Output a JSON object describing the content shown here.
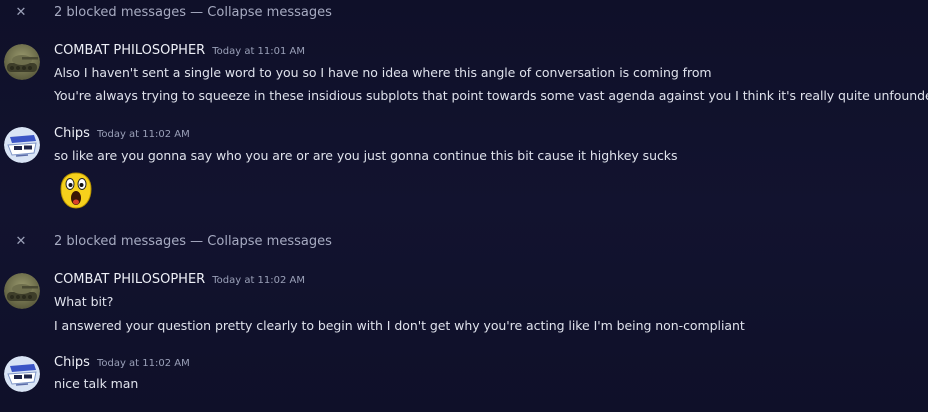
{
  "blocked_1": {
    "close_glyph": "✕",
    "count_text": "2 blocked messages",
    "separator": "—",
    "action": "Collapse messages"
  },
  "msg_1": {
    "username": "COMBAT PHILOSOPHER",
    "timestamp": "Today at 11:01 AM",
    "lines": [
      "Also I haven't sent a single word to you so I have no idea where this angle of conversation is coming from",
      "You're always trying to squeeze in these insidious subplots that point towards some vast agenda against you I think it's really quite unfounded"
    ]
  },
  "msg_2": {
    "username": "Chips",
    "timestamp": "Today at 11:02 AM",
    "lines": [
      "so like are you gonna say who you are or are you just gonna continue this bit cause it highkey sucks"
    ],
    "emoji": "screaming-yellow-face-icon"
  },
  "blocked_2": {
    "close_glyph": "✕",
    "count_text": "2 blocked messages",
    "separator": "—",
    "action": "Collapse messages"
  },
  "msg_3": {
    "username": "COMBAT PHILOSOPHER",
    "timestamp": "Today at 11:02 AM",
    "lines": [
      "What bit?",
      "I answered your question pretty clearly to begin with I don't get why you're acting like I'm being non-compliant"
    ]
  },
  "msg_4": {
    "username": "Chips",
    "timestamp": "Today at 11:02 AM",
    "lines": [
      "nice talk man"
    ]
  },
  "colors": {
    "background": "#10112a",
    "username": "#eef0f7",
    "timestamp": "#9aa0b8",
    "message_text": "#dfe2ec",
    "muted": "#a7abc2"
  }
}
